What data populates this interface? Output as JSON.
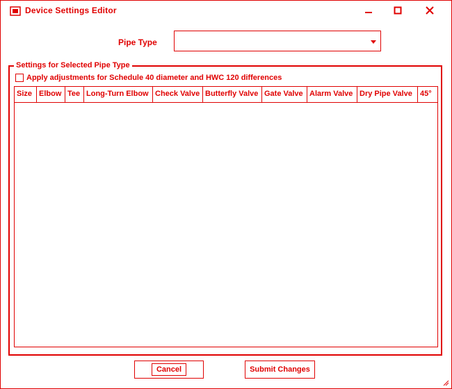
{
  "window": {
    "title": "Device Settings Editor",
    "icon": "app-icon",
    "controls": [
      "minimize-icon",
      "maximize-icon",
      "close-icon"
    ]
  },
  "pipe_type": {
    "label": "Pipe Type",
    "value": "",
    "dropdown_icon": "chevron-down-icon"
  },
  "group": {
    "legend": "Settings for Selected Pipe Type",
    "checkbox_label": "Apply adjustments for Schedule 40 diameter and HWC 120 differences",
    "checkbox_checked": false
  },
  "grid": {
    "columns": [
      "Size",
      "Elbow",
      "Tee",
      "Long-Turn Elbow",
      "Check Valve",
      "Butterfly Valve",
      "Gate Valve",
      "Alarm Valve",
      "Dry Pipe Valve",
      "45°"
    ],
    "rows": []
  },
  "footer": {
    "cancel_label": "Cancel",
    "submit_label": "Submit Changes"
  },
  "colors": {
    "accent": "#e00000",
    "background": "#ffffff"
  }
}
